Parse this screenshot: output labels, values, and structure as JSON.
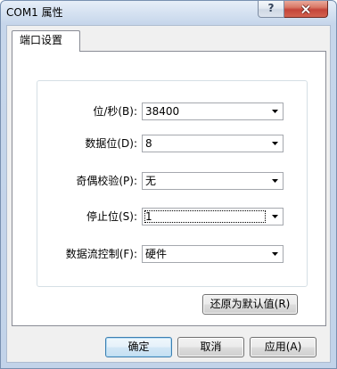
{
  "window": {
    "title": "COM1 属性",
    "help_glyph": "?"
  },
  "icons": {
    "help": "help-icon",
    "close": "close-icon",
    "dropdown": "chevron-down-icon"
  },
  "tabs": [
    {
      "label": "端口设置",
      "selected": true
    }
  ],
  "port_settings": [
    {
      "label": "位/秒(B):",
      "value": "38400"
    },
    {
      "label": "数据位(D):",
      "value": "8"
    },
    {
      "label": "奇偶校验(P):",
      "value": "无"
    },
    {
      "label": "停止位(S):",
      "value": "1",
      "focused": true
    },
    {
      "label": "数据流控制(F):",
      "value": "硬件"
    }
  ],
  "restore_defaults_button": "还原为默认值(R)",
  "dialog_buttons": {
    "ok": "确定",
    "cancel": "取消",
    "apply": "应用(A)"
  },
  "colors": {
    "title_bar": "#c6d6eb",
    "client_background": "#f0f0f0",
    "close_button": "#c4443a",
    "default_button_border": "#3c7fb1"
  }
}
